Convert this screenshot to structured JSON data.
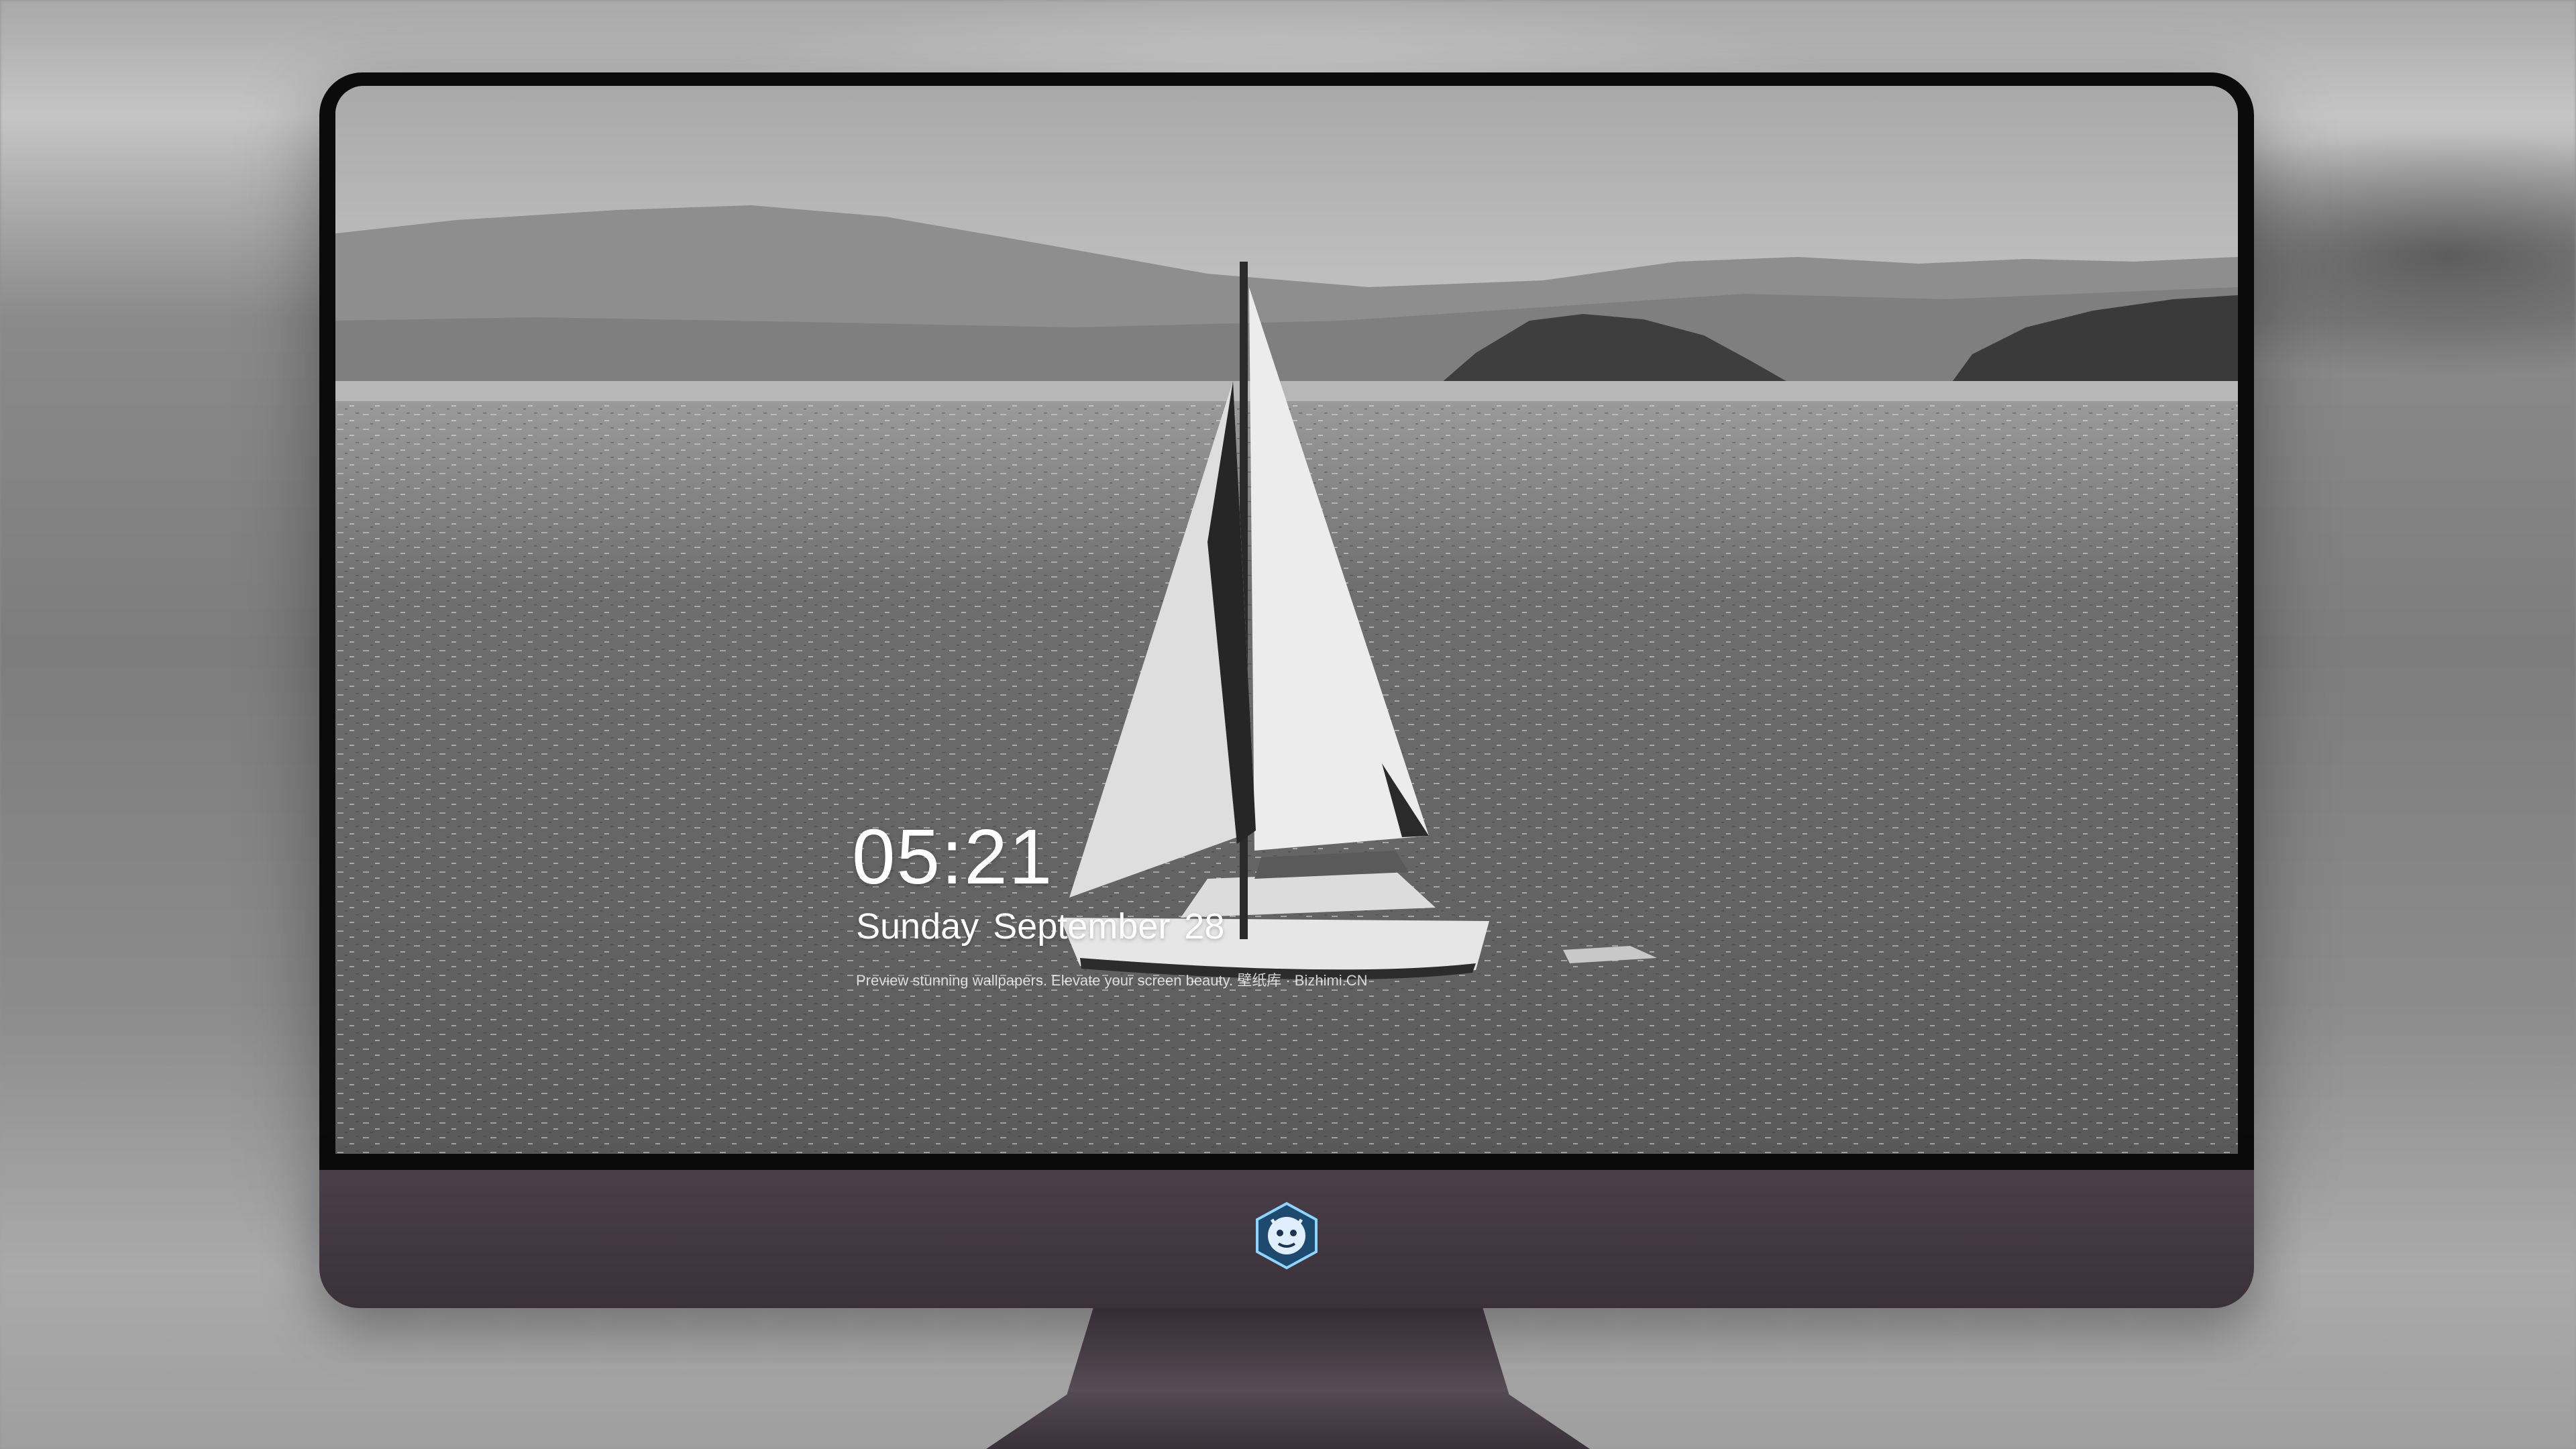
{
  "lock_screen": {
    "time": "05:21",
    "date": "Sunday September  28",
    "tagline": "Preview stunning wallpapers. Elevate your screen beauty. 壁纸库 · Bizhimi.CN"
  },
  "dock": {
    "apps": [
      {
        "name": "messages-icon",
        "color": "#34c759"
      },
      {
        "name": "weather-icon",
        "color": "#2f8cf0"
      },
      {
        "name": "clock-icon",
        "color": "#1c1c1e"
      },
      {
        "name": "preview-icon",
        "color": "#e8c24a"
      },
      {
        "name": "clips-icon",
        "color": "#29b6d6"
      },
      {
        "name": "notes-icon",
        "color": "#ffd84d"
      },
      {
        "name": "photo-booth-icon",
        "color": "#4aa3ff"
      },
      {
        "name": "music-icon",
        "color": "#e94fc9"
      },
      {
        "name": "app-store-icon",
        "color": "#1d8cf0"
      },
      {
        "name": "camera-icon",
        "color": "#8e8e93"
      }
    ]
  },
  "colors": {
    "bezel": "#0b0b0c",
    "chin": "#4a3f49",
    "clock_text": "#ffffff"
  }
}
